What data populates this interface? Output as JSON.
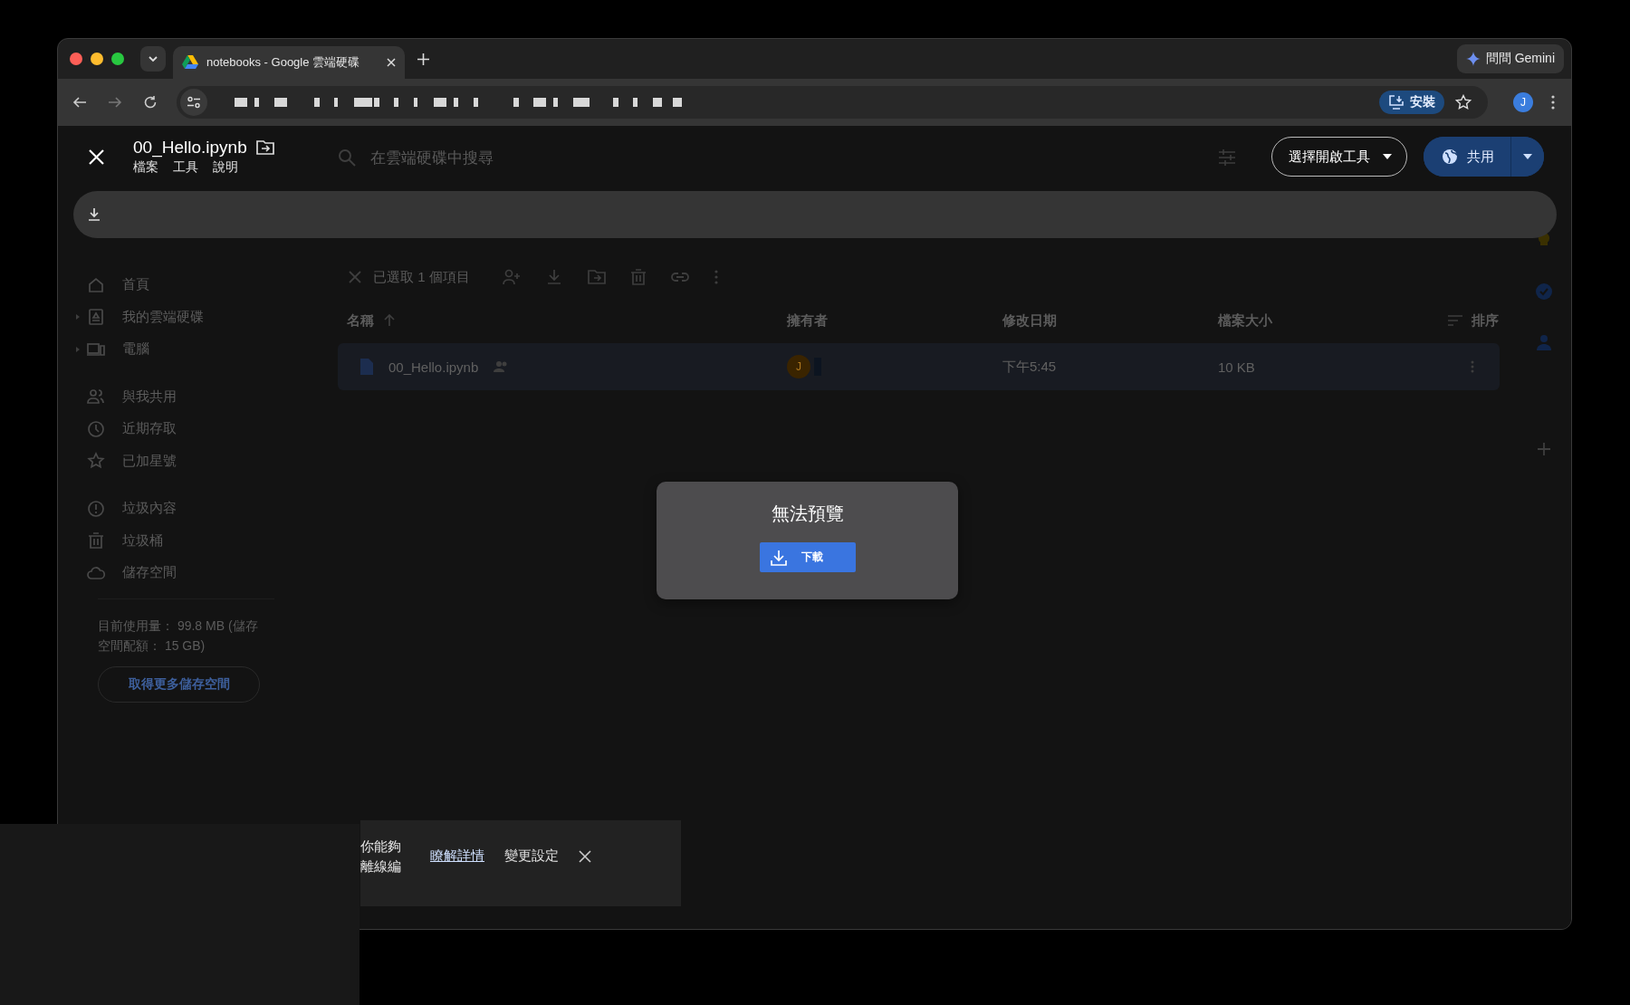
{
  "browser": {
    "tab": {
      "title": "notebooks - Google 雲端硬碟",
      "selected": true
    },
    "gemini_button": "問問 Gemini",
    "install_button": "安裝",
    "profile_initial": "J"
  },
  "viewer": {
    "file_name": "00_Hello.ipynb",
    "menu": [
      "檔案",
      "工具",
      "說明"
    ],
    "open_with_button": "選擇開啟工具",
    "share_button": "共用"
  },
  "drive_background": {
    "search_placeholder": "在雲端硬碟中搜尋",
    "sidebar_groups": [
      {
        "items": [
          {
            "label": "首頁",
            "kind": "home",
            "expandable": false
          },
          {
            "label": "我的雲端硬碟",
            "kind": "drive",
            "expandable": true
          },
          {
            "label": "電腦",
            "kind": "computer",
            "expandable": true
          }
        ]
      },
      {
        "items": [
          {
            "label": "與我共用",
            "kind": "people",
            "expandable": false
          },
          {
            "label": "近期存取",
            "kind": "clock",
            "expandable": false
          },
          {
            "label": "已加星號",
            "kind": "star",
            "expandable": false
          }
        ]
      },
      {
        "items": [
          {
            "label": "垃圾內容",
            "kind": "alert",
            "expandable": false
          },
          {
            "label": "垃圾桶",
            "kind": "trash",
            "expandable": false
          },
          {
            "label": "儲存空間",
            "kind": "cloud",
            "expandable": false
          }
        ]
      }
    ],
    "storage_text": "目前使用量： 99.8 MB (儲存空間配額： 15 GB)",
    "storage_button": "取得更多儲存空間",
    "selection_text": "已選取 1 個項目",
    "columns": [
      "名稱",
      "擁有者",
      "修改日期",
      "檔案大小"
    ],
    "sort_label": "排序",
    "rows": [
      {
        "name": "00_Hello.ipynb",
        "owner_initial": "J",
        "modified": "下午5:45",
        "size": "10 KB",
        "selected": true
      }
    ]
  },
  "preview": {
    "message": "無法預覽",
    "download_button": "下載"
  },
  "snackbar": {
    "text_lines": [
      "你能夠",
      "離線編"
    ],
    "link": "瞭解詳情",
    "action": "變更設定"
  }
}
